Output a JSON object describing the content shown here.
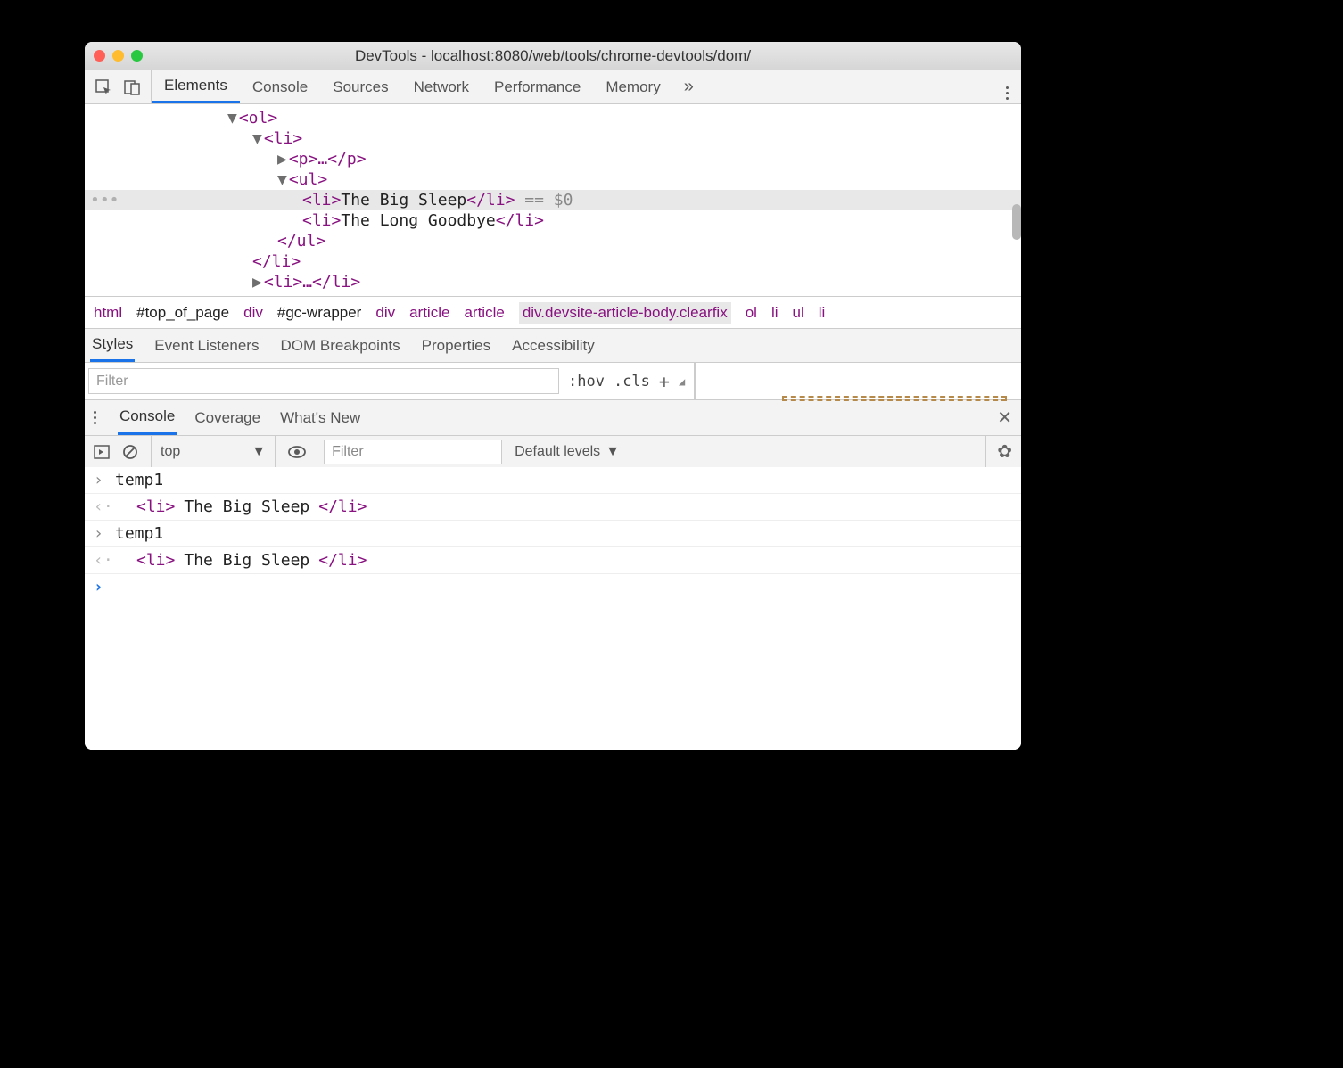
{
  "window": {
    "title": "DevTools - localhost:8080/web/tools/chrome-devtools/dom/"
  },
  "main_tabs": [
    "Elements",
    "Console",
    "Sources",
    "Network",
    "Performance",
    "Memory"
  ],
  "main_tabs_active": 0,
  "dom_tree": {
    "lines": [
      {
        "indent": 0,
        "arrow": "▼",
        "html": "<ol>"
      },
      {
        "indent": 1,
        "arrow": "▼",
        "html": "<li>"
      },
      {
        "indent": 2,
        "arrow": "▶",
        "html": "<p>…</p>"
      },
      {
        "indent": 2,
        "arrow": "▼",
        "html": "<ul>"
      },
      {
        "indent": 3,
        "arrow": "",
        "html_open": "<li>",
        "text": "The Big Sleep",
        "html_close": "</li>",
        "ref": " == $0",
        "selected": true
      },
      {
        "indent": 3,
        "arrow": "",
        "html_open": "<li>",
        "text": "The Long Goodbye",
        "html_close": "</li>"
      },
      {
        "indent": 2,
        "arrow": "",
        "html": "</ul>"
      },
      {
        "indent": 1,
        "arrow": "",
        "html": "</li>"
      },
      {
        "indent": 1,
        "arrow": "▶",
        "html": "<li>…</li>"
      }
    ]
  },
  "breadcrumbs": [
    {
      "label": "html",
      "dark": false
    },
    {
      "label": "#top_of_page",
      "dark": true
    },
    {
      "label": "div",
      "dark": false
    },
    {
      "label": "#gc-wrapper",
      "dark": true
    },
    {
      "label": "div",
      "dark": false
    },
    {
      "label": "article",
      "dark": false
    },
    {
      "label": "article",
      "dark": false
    },
    {
      "label": "div.devsite-article-body.clearfix",
      "dark": false,
      "highlight": true
    },
    {
      "label": "ol",
      "dark": false
    },
    {
      "label": "li",
      "dark": false
    },
    {
      "label": "ul",
      "dark": false
    },
    {
      "label": "li",
      "dark": false
    }
  ],
  "styles_tabs": [
    "Styles",
    "Event Listeners",
    "DOM Breakpoints",
    "Properties",
    "Accessibility"
  ],
  "styles_tab_active": 0,
  "filter_placeholder": "Filter",
  "hov": ":hov",
  "cls": ".cls",
  "drawer_tabs": [
    "Console",
    "Coverage",
    "What's New"
  ],
  "drawer_tab_active": 0,
  "console_toolbar": {
    "context": "top",
    "filter_placeholder": "Filter",
    "levels": "Default levels"
  },
  "console_lines": [
    {
      "type": "in",
      "text": "temp1"
    },
    {
      "type": "out",
      "html_open": "<li>",
      "text": "The Big Sleep",
      "html_close": "</li>"
    },
    {
      "type": "in",
      "text": "temp1"
    },
    {
      "type": "out",
      "html_open": "<li>",
      "text": "The Big Sleep",
      "html_close": "</li>"
    },
    {
      "type": "prompt"
    }
  ]
}
